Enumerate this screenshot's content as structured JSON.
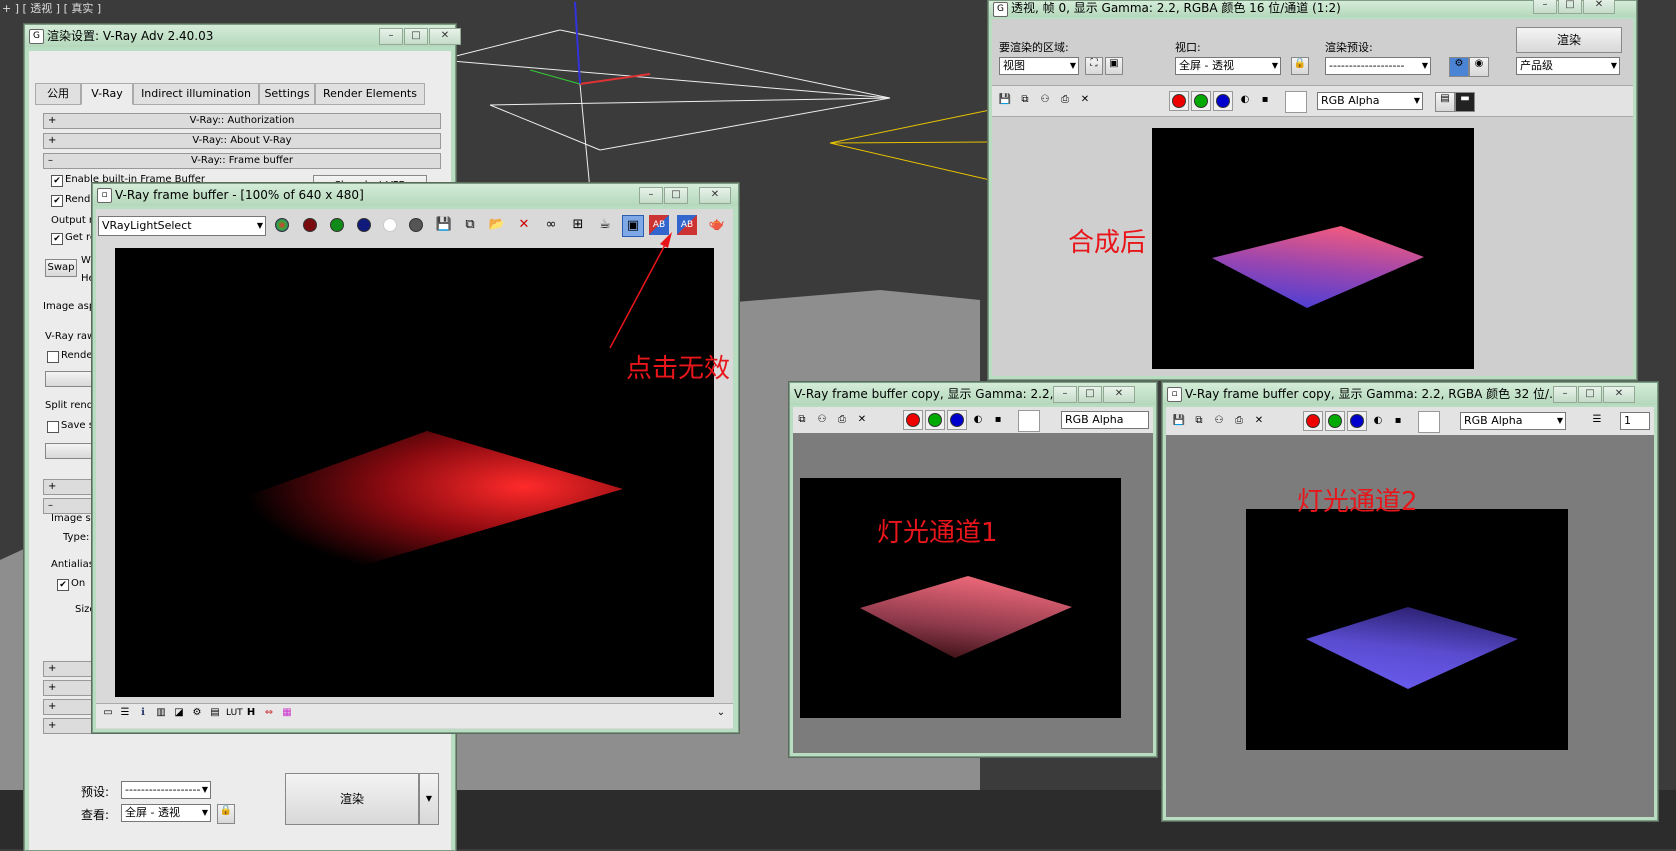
{
  "viewport": {
    "label": "+ ] [ 透视 ] [ 真实 ]"
  },
  "render_setup": {
    "title": "渲染设置: V-Ray Adv 2.40.03",
    "tabs": [
      "公用",
      "V-Ray",
      "Indirect illumination",
      "Settings",
      "Render Elements"
    ],
    "rollouts": {
      "authorization": "V-Ray:: Authorization",
      "about": "V-Ray:: About V-Ray",
      "frame_buffer": "V-Ray:: Frame buffer"
    },
    "enable_vfb": "Enable built-in Frame Buffer",
    "render_memory": "Render to memory frame buffer",
    "show_last_vfb": "Show last VFB",
    "output_res": "Output re",
    "get_res": "Get re",
    "swap": "Swap",
    "w_label": "W",
    "h_label": "He",
    "image_aspect": "Image asp",
    "vray_raw": "V-Ray raw",
    "render_raw": "Rende",
    "split_render": "Split rend",
    "save_sep": "Save s",
    "image_sampler": "Image sa",
    "type_label": "Type:",
    "antialiasing": "Antialiasi",
    "on_label": "On",
    "size_label": "Size",
    "preset_label": "预设:",
    "preset_value": "-------------------",
    "view_label": "查看:",
    "view_value": "全屏 - 透视",
    "render_button": "渲染"
  },
  "vfb": {
    "title": "V-Ray frame buffer - [100% of 640 x 480]",
    "channel": "VRayLightSelect",
    "icons": [
      "color-wheel-icon",
      "red-channel-icon",
      "green-channel-icon",
      "blue-channel-icon",
      "alpha-channel-icon",
      "mono-channel-icon",
      "save-icon",
      "save-all-icon",
      "load-icon",
      "clear-icon",
      "link-icon",
      "region-render-icon",
      "render-teapot-icon",
      "lut-compare-icon",
      "ab-horizontal-icon",
      "ab-vertical-icon",
      "teapot-icon"
    ],
    "bottom_icons": [
      "display-icon",
      "history-icon",
      "info-icon",
      "levels-icon",
      "curve-icon",
      "settings-icon",
      "srgb-icon",
      "lut-icon",
      "H",
      "compare-icon",
      "stamp-icon"
    ],
    "h_label": "H",
    "lut_label": "LUT"
  },
  "annotation_click": "点击无效",
  "render_window": {
    "title": "透视, 帧 0, 显示 Gamma: 2.2, RGBA 颜色 16 位/通道 (1:2)",
    "area_label": "要渲染的区域:",
    "area_value": "视图",
    "viewport_label": "视口:",
    "viewport_value": "全屏 - 透视",
    "preset_label": "渲染预设:",
    "preset_value": "-------------------",
    "render_button": "渲染",
    "quality_value": "产品级",
    "channel": "RGB Alpha",
    "caption": "合成后"
  },
  "copy1": {
    "title": "V-Ray frame buffer copy, 显示 Gamma: 2.2,...",
    "channel": "RGB Alpha",
    "caption": "灯光通道1"
  },
  "copy2": {
    "title": "V-Ray frame buffer copy, 显示 Gamma: 2.2, RGBA 颜色 32 位/...",
    "channel": "RGB Alpha",
    "layer_value": "1",
    "caption": "灯光通道2"
  },
  "colors": {
    "annotation": "#e8161b",
    "window_frame": "#b9ddc0",
    "viewport": "#3b3b3b"
  }
}
